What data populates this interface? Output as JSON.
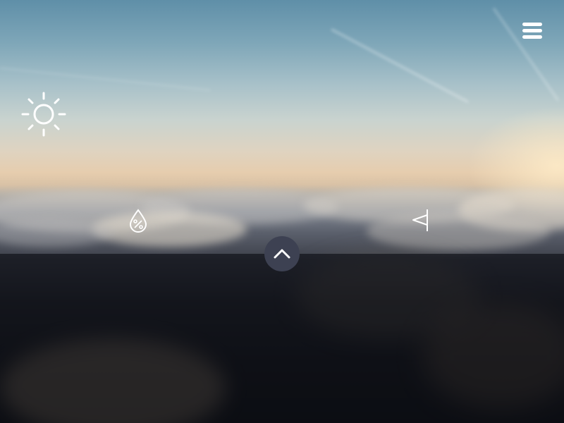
{
  "icons": {
    "menu": "hamburger-menu-icon",
    "weather": "sun-icon",
    "humidity": "water-drop-percent-icon",
    "wind": "wind-flag-icon",
    "expand": "chevron-up-icon"
  },
  "colors": {
    "icon": "#ffffff",
    "panel_overlay": "rgba(10,12,18,0.62)",
    "expand_button": "#3d4152"
  }
}
